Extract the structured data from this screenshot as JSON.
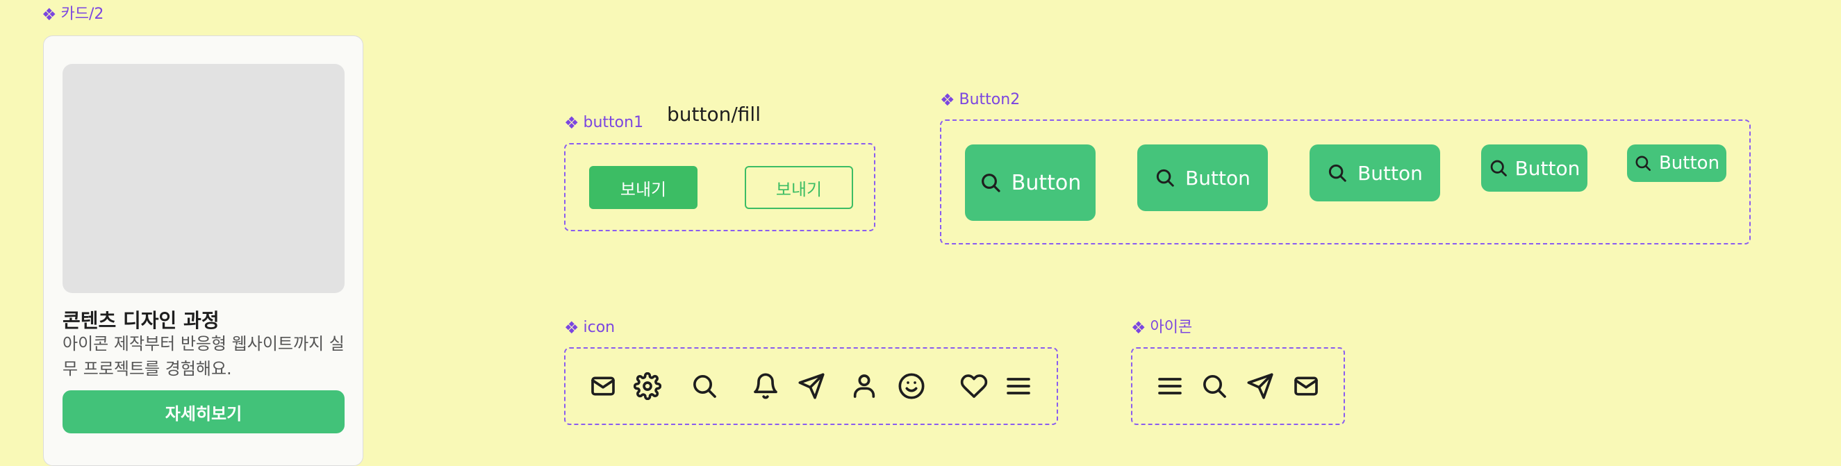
{
  "card": {
    "label": "카드/2",
    "title": "콘텐츠 디자인 과정",
    "description": "아이콘 제작부터 반응형 웹사이트까지 실무 프로젝트를 경험해요.",
    "cta_label": "자세히보기"
  },
  "button1": {
    "label": "button1",
    "fill_label": "button/fill",
    "send_fill": "보내기",
    "send_outline": "보내기"
  },
  "button2": {
    "label": "Button2",
    "buttons": [
      "Button",
      "Button",
      "Button",
      "Button",
      "Button"
    ]
  },
  "icon_set": {
    "label": "icon",
    "icons": [
      "mail-icon",
      "gear-icon",
      "search-icon",
      "bell-icon",
      "send-icon",
      "user-icon",
      "smile-icon",
      "heart-icon",
      "menu-icon"
    ]
  },
  "icon_set_ko": {
    "label": "아이콘",
    "icons": [
      "menu-icon",
      "search-icon",
      "send-icon",
      "mail-icon"
    ]
  },
  "colors": {
    "background": "#f9f9b7",
    "component_purple": "#7b46e0",
    "primary_green": "#3cbd64",
    "button_green": "#45c47b"
  }
}
